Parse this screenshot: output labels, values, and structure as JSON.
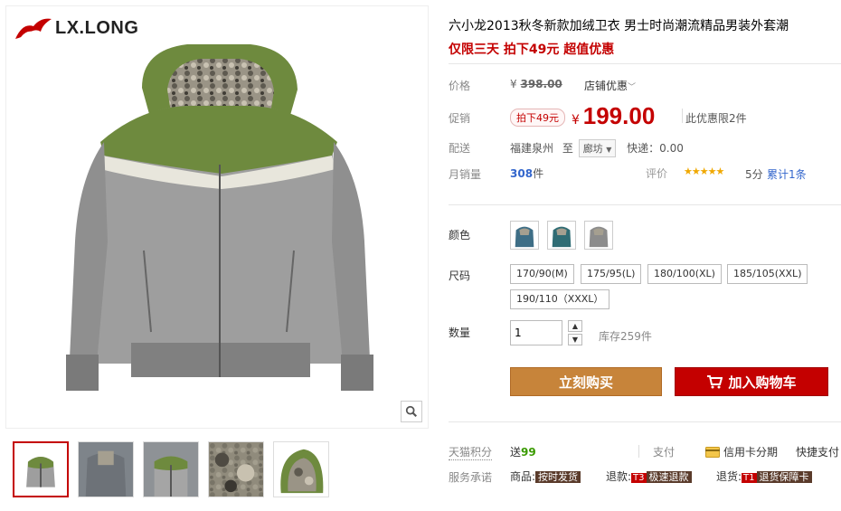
{
  "brand": {
    "name": "LX.LONG"
  },
  "product": {
    "title": "六小龙2013秋冬新款加绒卫衣 男士时尚潮流精品男装外套潮",
    "promo": "仅限三天 拍下49元 超值优惠"
  },
  "price": {
    "label": "价格",
    "currency": "¥",
    "original": "398.00",
    "shop_discount": "店铺优惠"
  },
  "sale": {
    "label": "促销",
    "tag": "拍下49元",
    "currency": "¥",
    "price": "199.00",
    "limit": "此优惠限2件"
  },
  "shipping": {
    "label": "配送",
    "from": "福建泉州",
    "to_word": "至",
    "dest": "廊坊",
    "fee": "快递：0.00"
  },
  "sales": {
    "label": "月销量",
    "count": "308",
    "unit": "件",
    "rating_label": "评价",
    "stars": "★★★★★",
    "score": "5分",
    "reviews": "累计1条"
  },
  "color": {
    "label": "颜色",
    "swatches": [
      "blue",
      "teal",
      "gray"
    ]
  },
  "size": {
    "label": "尺码",
    "options": [
      "170/90(M)",
      "175/95(L)",
      "180/100(XL)",
      "185/105(XXL)",
      "190/110（XXXL）"
    ]
  },
  "quantity": {
    "label": "数量",
    "value": "1",
    "stock": "库存259件"
  },
  "actions": {
    "buy": "立刻购买",
    "cart": "加入购物车"
  },
  "points": {
    "label": "天猫积分",
    "prefix": "送",
    "value": "99",
    "pay_label": "支付",
    "credit": "信用卡分期",
    "fast_pay": "快捷支付"
  },
  "service": {
    "label": "服务承诺",
    "goods_prefix": "商品:",
    "goods_badge": "按时发货",
    "refund_prefix": "退款:",
    "refund_code": "T3",
    "refund_badge": "极速退款",
    "return_prefix": "退货:",
    "return_code": "T1",
    "return_badge": "退货保障卡"
  },
  "colors": {
    "accent": "#c40000",
    "buy": "#c7843a",
    "jacket_green": "#6e8a3e",
    "jacket_gray": "#9c9c9c"
  }
}
